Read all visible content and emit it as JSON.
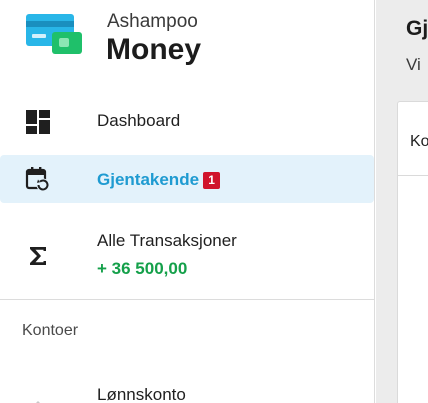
{
  "app": {
    "brand_top": "Ashampoo",
    "brand_main": "Money",
    "logo_icon": "credit-card-logo"
  },
  "sidebar": {
    "items": [
      {
        "label": "Dashboard",
        "icon": "dashboard-icon"
      },
      {
        "label": "Gjentakende",
        "icon": "recurring-calendar-icon",
        "badge": "1",
        "selected": true
      },
      {
        "label": "Alle Transaksjoner",
        "icon": "sigma-icon",
        "amount": "+ 36 500,00"
      }
    ],
    "section_title": "Kontoer",
    "accounts": [
      {
        "label": "Lønnskonto",
        "icon": "account-icon"
      }
    ]
  },
  "main": {
    "title": "Gjentakende",
    "subtitle": "Vi",
    "card_header": "Ko"
  },
  "colors": {
    "accent": "#1f9bd1",
    "selected_bg": "#e3f2fb",
    "badge": "#d0142c",
    "positive": "#14a04a",
    "main_bg": "#ececec"
  }
}
